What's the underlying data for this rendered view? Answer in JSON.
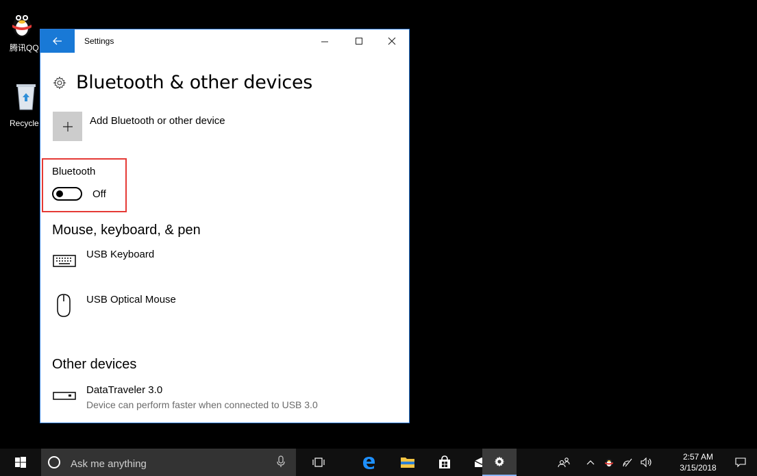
{
  "desktop": {
    "icons": [
      {
        "label": "腾讯QQ"
      },
      {
        "label": "Recycle Bin"
      }
    ]
  },
  "window": {
    "title": "Settings",
    "back_icon": "back-arrow-icon",
    "controls": {
      "minimize": "minimize-icon",
      "maximize": "maximize-icon",
      "close": "close-icon"
    }
  },
  "page": {
    "title": "Bluetooth & other devices",
    "add_device_label": "Add Bluetooth or other device",
    "bluetooth": {
      "label": "Bluetooth",
      "state": "Off",
      "enabled": false
    },
    "mouse_section": {
      "heading": "Mouse, keyboard, & pen",
      "devices": [
        {
          "name": "USB Keyboard",
          "icon": "keyboard-icon"
        },
        {
          "name": "USB Optical Mouse",
          "icon": "mouse-icon"
        }
      ]
    },
    "other_section": {
      "heading": "Other devices",
      "devices": [
        {
          "name": "DataTraveler 3.0",
          "detail": "Device can perform faster when connected to USB 3.0",
          "icon": "usb-drive-icon"
        }
      ]
    }
  },
  "taskbar": {
    "search_placeholder": "Ask me anything",
    "clock_time": "2:57 AM",
    "clock_date": "3/15/2018",
    "accent": "#1979d6"
  }
}
